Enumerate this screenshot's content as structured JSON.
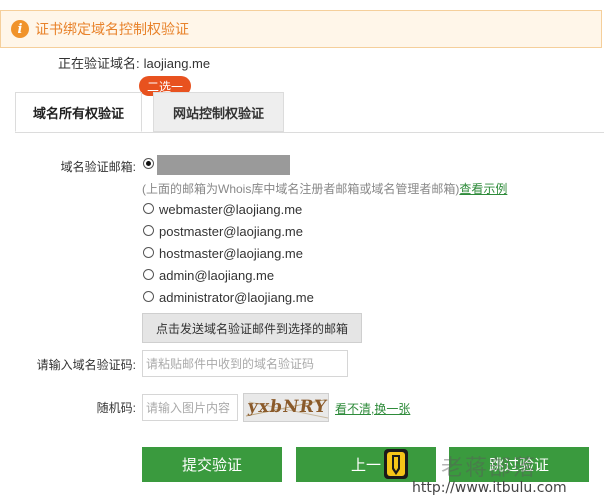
{
  "notice": {
    "icon": "info-icon",
    "title": "证书绑定域名控制权验证",
    "accent": "#f0932b"
  },
  "domain": {
    "label": "正在验证域名:",
    "value": "laojiang.me"
  },
  "tabs": [
    {
      "label": "域名所有权验证",
      "active": true
    },
    {
      "label": "网站控制权验证",
      "active": false
    }
  ],
  "bubble": "二选一",
  "email": {
    "label": "域名验证邮箱:",
    "hint_text": "(上面的邮箱为Whois库中域名注册者邮箱或域名管理者邮箱)",
    "hint_link": "查看示例",
    "options": [
      "webmaster@laojiang.me",
      "postmaster@laojiang.me",
      "hostmaster@laojiang.me",
      "admin@laojiang.me",
      "administrator@laojiang.me"
    ],
    "send_button": "点击发送域名验证邮件到选择的邮箱"
  },
  "code": {
    "label": "请输入域名验证码:",
    "placeholder": "请粘贴邮件中收到的域名验证码"
  },
  "captcha": {
    "label": "随机码:",
    "placeholder": "请输入图片内容",
    "image_text": "yxbNRY",
    "refresh": "看不清,换一张"
  },
  "actions": {
    "submit": "提交验证",
    "prev": "上一",
    "skip": "跳过验证"
  },
  "watermark": {
    "brand": "老蒋部落",
    "url": "http://www.itbulu.com"
  },
  "colors": {
    "primary_green": "#3a9a3e",
    "link_green": "#2e8b3a",
    "bubble": "#e8521f"
  }
}
